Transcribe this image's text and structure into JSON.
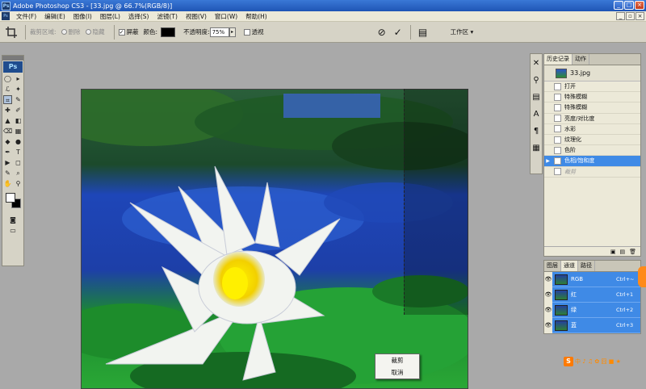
{
  "window": {
    "title": "Adobe Photoshop CS3 - [33.jpg @ 66.7%(RGB/8)]",
    "logo": "Ps"
  },
  "menubar": {
    "items": [
      "文件(F)",
      "编辑(E)",
      "图像(I)",
      "图层(L)",
      "选择(S)",
      "滤镜(T)",
      "视图(V)",
      "窗口(W)",
      "帮助(H)"
    ]
  },
  "options": {
    "cropped_area_label": "裁剪区域:",
    "delete_label": "删除",
    "hide_label": "隐藏",
    "shield_label": "屏蔽",
    "shield_checked": "✓",
    "color_label": "颜色:",
    "color_value": "#000000",
    "opacity_label": "不透明度:",
    "opacity_value": "75%",
    "perspective_label": "透视",
    "workspace_label": "工作区 ▾"
  },
  "toolbox": {
    "badge": "Ps",
    "tools": [
      "◯",
      "▸",
      "ℒ",
      "✦",
      "⌗",
      "✎",
      "✚",
      "✐",
      "▲",
      "◧",
      "⌫",
      "▦",
      "◆",
      "●",
      "✒",
      "T",
      "▶",
      "◻",
      "✋",
      "⚲"
    ]
  },
  "context_menu": {
    "items": [
      "裁剪",
      "取消"
    ]
  },
  "history": {
    "tabs": [
      "历史记录",
      "动作"
    ],
    "snapshot": "33.jpg",
    "items": [
      {
        "label": "打开",
        "state": "normal"
      },
      {
        "label": "特殊模糊",
        "state": "normal"
      },
      {
        "label": "特殊模糊",
        "state": "normal"
      },
      {
        "label": "亮度/对比度",
        "state": "normal"
      },
      {
        "label": "水彩",
        "state": "normal"
      },
      {
        "label": "纹理化",
        "state": "normal"
      },
      {
        "label": "色阶",
        "state": "normal"
      },
      {
        "label": "色相/饱和度",
        "state": "selected"
      },
      {
        "label": "裁剪",
        "state": "dimmed"
      }
    ]
  },
  "channels": {
    "tabs": [
      "图层",
      "通道",
      "路径"
    ],
    "rows": [
      {
        "name": "RGB",
        "shortcut": "Ctrl+~"
      },
      {
        "name": "红",
        "shortcut": "Ctrl+1"
      },
      {
        "name": "绿",
        "shortcut": "Ctrl+2"
      },
      {
        "name": "蓝",
        "shortcut": "Ctrl+3"
      }
    ]
  },
  "watermark": {
    "logo": "S",
    "text": "中 ♪ ♫ ✿ 囧 ■ ★"
  },
  "colors": {
    "selection_blue": "#3f8ae6",
    "panel_bg": "#ece9d8",
    "title_blue": "#1f55b5"
  }
}
